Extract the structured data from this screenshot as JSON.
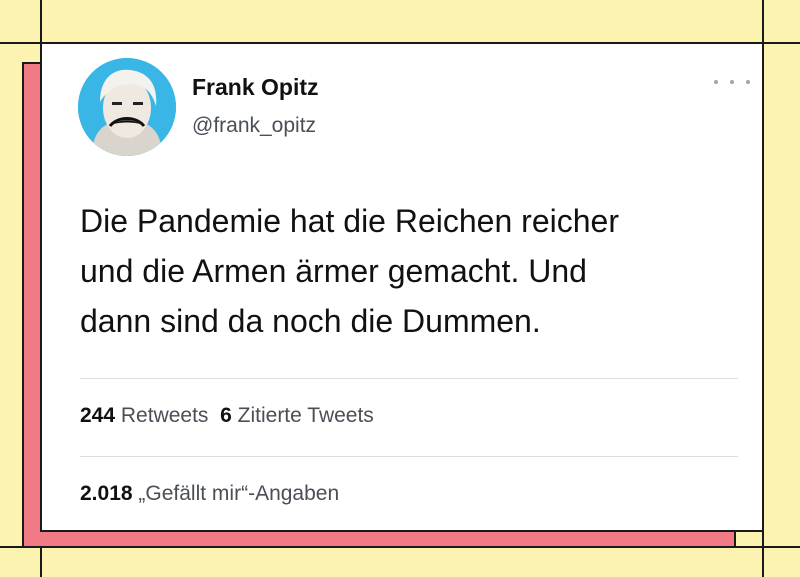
{
  "author": {
    "name": "Frank Opitz",
    "handle": "@frank_opitz",
    "avatar_icon": "avatar-photo"
  },
  "more_icon": "ellipsis-icon",
  "tweet": {
    "lines": [
      "Die Pandemie hat die Reichen reicher",
      "und die Armen ärmer gemacht. Und",
      "dann sind da noch die Dummen."
    ]
  },
  "stats": {
    "retweets_count": "244",
    "retweets_label": "Retweets",
    "quotes_count": "6",
    "quotes_label": "Zitierte Tweets",
    "likes_count": "2.018",
    "likes_label": "„Gefällt mir“-Angaben"
  },
  "colors": {
    "background": "#fdf3b0",
    "shadow": "#f07a86",
    "avatar_bg": "#3ab6e6"
  }
}
